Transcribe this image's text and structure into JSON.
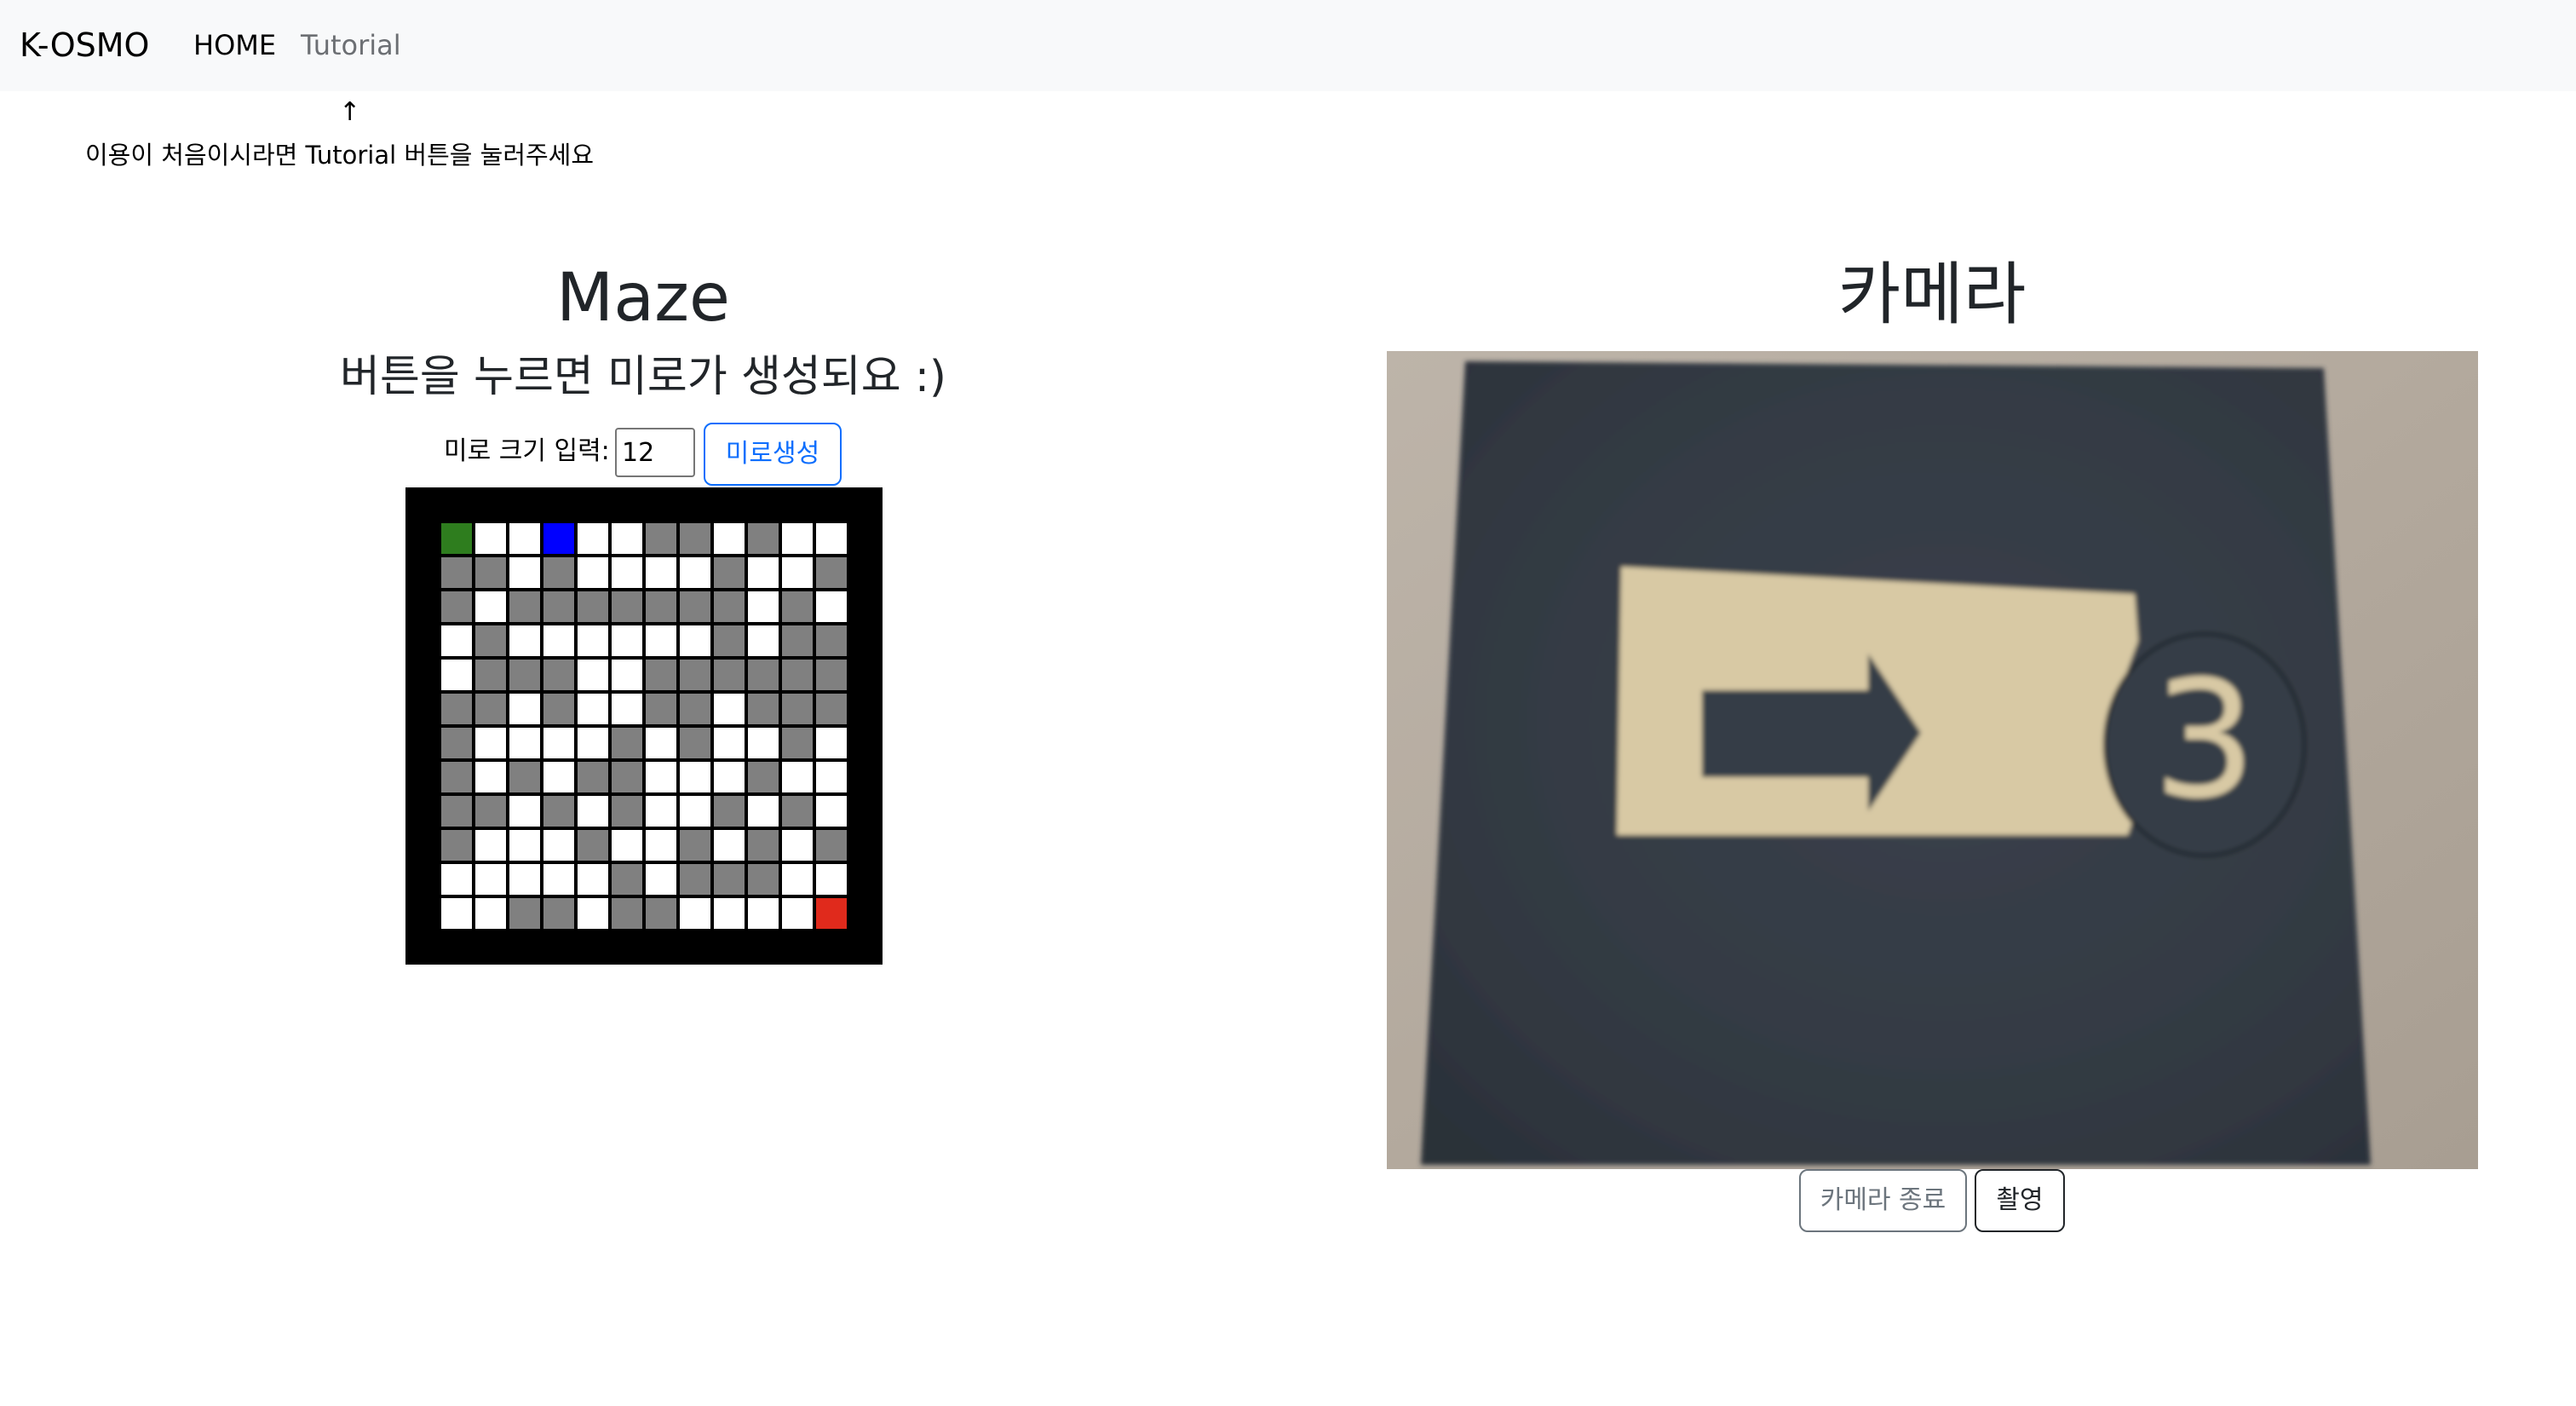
{
  "nav": {
    "brand": "K-OSMO",
    "home": "HOME",
    "tutorial": "Tutorial"
  },
  "hint": {
    "arrow": "↑",
    "text": "이용이 처음이시라면 Tutorial 버튼을 눌러주세요"
  },
  "maze": {
    "title": "Maze",
    "subtitle": "버튼을 누르면 미로가 생성되요 :)",
    "size_label": "미로 크기 입력:",
    "size_value": "12",
    "generate_label": "미로생성",
    "colors": {
      "wall": "#808080",
      "path": "#ffffff",
      "start": "#2e7d1e",
      "player": "#0000ff",
      "goal": "#e02a1c",
      "border": "#000000"
    },
    "grid": [
      "SPPBPPWWPWPP",
      "WWPWPPPPWPPW",
      "WPWWWWWWWPWP",
      "PWPPPPPPWPWW",
      "PWWWPPWWWWWW",
      "WWPWPPWWPWWW",
      "WPPPPWPWPPWP",
      "WPWPWWPPPWPP",
      "WWPWPWPPWPWP",
      "WPPPWPPWPWPW",
      "PPPPPWPWWWPP",
      "PPWWPWWPPPPG"
    ]
  },
  "camera": {
    "title": "카메라",
    "stop_label": "카메라 종료",
    "shoot_label": "촬영",
    "card_number": "3",
    "colors": {
      "background": "#b0a79c",
      "card": "#363d46",
      "insert": "#d8c9a4",
      "arrow": "#363d46"
    }
  }
}
